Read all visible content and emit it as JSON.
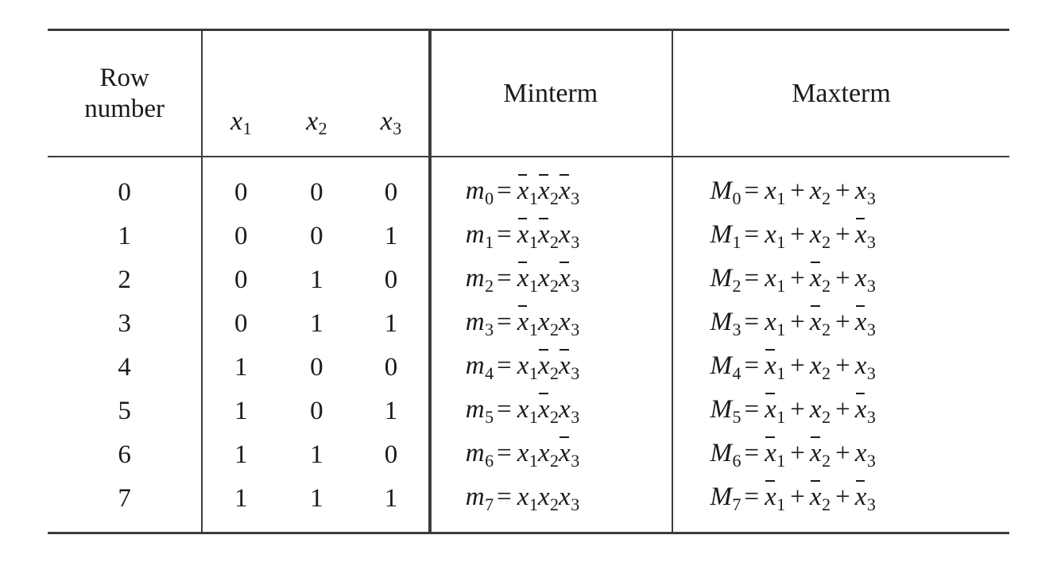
{
  "table": {
    "headers": {
      "row_number_line1": "Row",
      "row_number_line2": "number",
      "x1": "x",
      "x1_sub": "1",
      "x2": "x",
      "x2_sub": "2",
      "x3": "x",
      "x3_sub": "3",
      "minterm": "Minterm",
      "maxterm": "Maxterm"
    },
    "rows": [
      {
        "row_number": "0",
        "x1": "0",
        "x2": "0",
        "x3": "0",
        "minterm_name": "m",
        "minterm_sub": "0",
        "minterm_vars": [
          {
            "letter": "x",
            "sub": "1",
            "negated": true
          },
          {
            "letter": "x",
            "sub": "2",
            "negated": true
          },
          {
            "letter": "x",
            "sub": "3",
            "negated": true
          }
        ],
        "maxterm_name": "M",
        "maxterm_sub": "0",
        "maxterm_vars": [
          {
            "letter": "x",
            "sub": "1",
            "negated": false
          },
          {
            "letter": "x",
            "sub": "2",
            "negated": false
          },
          {
            "letter": "x",
            "sub": "3",
            "negated": false
          }
        ]
      },
      {
        "row_number": "1",
        "x1": "0",
        "x2": "0",
        "x3": "1",
        "minterm_name": "m",
        "minterm_sub": "1",
        "minterm_vars": [
          {
            "letter": "x",
            "sub": "1",
            "negated": true
          },
          {
            "letter": "x",
            "sub": "2",
            "negated": true
          },
          {
            "letter": "x",
            "sub": "3",
            "negated": false
          }
        ],
        "maxterm_name": "M",
        "maxterm_sub": "1",
        "maxterm_vars": [
          {
            "letter": "x",
            "sub": "1",
            "negated": false
          },
          {
            "letter": "x",
            "sub": "2",
            "negated": false
          },
          {
            "letter": "x",
            "sub": "3",
            "negated": true
          }
        ]
      },
      {
        "row_number": "2",
        "x1": "0",
        "x2": "1",
        "x3": "0",
        "minterm_name": "m",
        "minterm_sub": "2",
        "minterm_vars": [
          {
            "letter": "x",
            "sub": "1",
            "negated": true
          },
          {
            "letter": "x",
            "sub": "2",
            "negated": false
          },
          {
            "letter": "x",
            "sub": "3",
            "negated": true
          }
        ],
        "maxterm_name": "M",
        "maxterm_sub": "2",
        "maxterm_vars": [
          {
            "letter": "x",
            "sub": "1",
            "negated": false
          },
          {
            "letter": "x",
            "sub": "2",
            "negated": true
          },
          {
            "letter": "x",
            "sub": "3",
            "negated": false
          }
        ]
      },
      {
        "row_number": "3",
        "x1": "0",
        "x2": "1",
        "x3": "1",
        "minterm_name": "m",
        "minterm_sub": "3",
        "minterm_vars": [
          {
            "letter": "x",
            "sub": "1",
            "negated": true
          },
          {
            "letter": "x",
            "sub": "2",
            "negated": false
          },
          {
            "letter": "x",
            "sub": "3",
            "negated": false
          }
        ],
        "maxterm_name": "M",
        "maxterm_sub": "3",
        "maxterm_vars": [
          {
            "letter": "x",
            "sub": "1",
            "negated": false
          },
          {
            "letter": "x",
            "sub": "2",
            "negated": true
          },
          {
            "letter": "x",
            "sub": "3",
            "negated": true
          }
        ]
      },
      {
        "row_number": "4",
        "x1": "1",
        "x2": "0",
        "x3": "0",
        "minterm_name": "m",
        "minterm_sub": "4",
        "minterm_vars": [
          {
            "letter": "x",
            "sub": "1",
            "negated": false
          },
          {
            "letter": "x",
            "sub": "2",
            "negated": true
          },
          {
            "letter": "x",
            "sub": "3",
            "negated": true
          }
        ],
        "maxterm_name": "M",
        "maxterm_sub": "4",
        "maxterm_vars": [
          {
            "letter": "x",
            "sub": "1",
            "negated": true
          },
          {
            "letter": "x",
            "sub": "2",
            "negated": false
          },
          {
            "letter": "x",
            "sub": "3",
            "negated": false
          }
        ]
      },
      {
        "row_number": "5",
        "x1": "1",
        "x2": "0",
        "x3": "1",
        "minterm_name": "m",
        "minterm_sub": "5",
        "minterm_vars": [
          {
            "letter": "x",
            "sub": "1",
            "negated": false
          },
          {
            "letter": "x",
            "sub": "2",
            "negated": true
          },
          {
            "letter": "x",
            "sub": "3",
            "negated": false
          }
        ],
        "maxterm_name": "M",
        "maxterm_sub": "5",
        "maxterm_vars": [
          {
            "letter": "x",
            "sub": "1",
            "negated": true
          },
          {
            "letter": "x",
            "sub": "2",
            "negated": false
          },
          {
            "letter": "x",
            "sub": "3",
            "negated": true
          }
        ]
      },
      {
        "row_number": "6",
        "x1": "1",
        "x2": "1",
        "x3": "0",
        "minterm_name": "m",
        "minterm_sub": "6",
        "minterm_vars": [
          {
            "letter": "x",
            "sub": "1",
            "negated": false
          },
          {
            "letter": "x",
            "sub": "2",
            "negated": false
          },
          {
            "letter": "x",
            "sub": "3",
            "negated": true
          }
        ],
        "maxterm_name": "M",
        "maxterm_sub": "6",
        "maxterm_vars": [
          {
            "letter": "x",
            "sub": "1",
            "negated": true
          },
          {
            "letter": "x",
            "sub": "2",
            "negated": true
          },
          {
            "letter": "x",
            "sub": "3",
            "negated": false
          }
        ]
      },
      {
        "row_number": "7",
        "x1": "1",
        "x2": "1",
        "x3": "1",
        "minterm_name": "m",
        "minterm_sub": "7",
        "minterm_vars": [
          {
            "letter": "x",
            "sub": "1",
            "negated": false
          },
          {
            "letter": "x",
            "sub": "2",
            "negated": false
          },
          {
            "letter": "x",
            "sub": "3",
            "negated": false
          }
        ],
        "maxterm_name": "M",
        "maxterm_sub": "7",
        "maxterm_vars": [
          {
            "letter": "x",
            "sub": "1",
            "negated": true
          },
          {
            "letter": "x",
            "sub": "2",
            "negated": true
          },
          {
            "letter": "x",
            "sub": "3",
            "negated": true
          }
        ]
      }
    ],
    "symbols": {
      "equals": "=",
      "plus": "+"
    },
    "colors": {
      "rule": "#3b3b3b",
      "text": "#1a1a1a",
      "background": "#ffffff"
    }
  }
}
